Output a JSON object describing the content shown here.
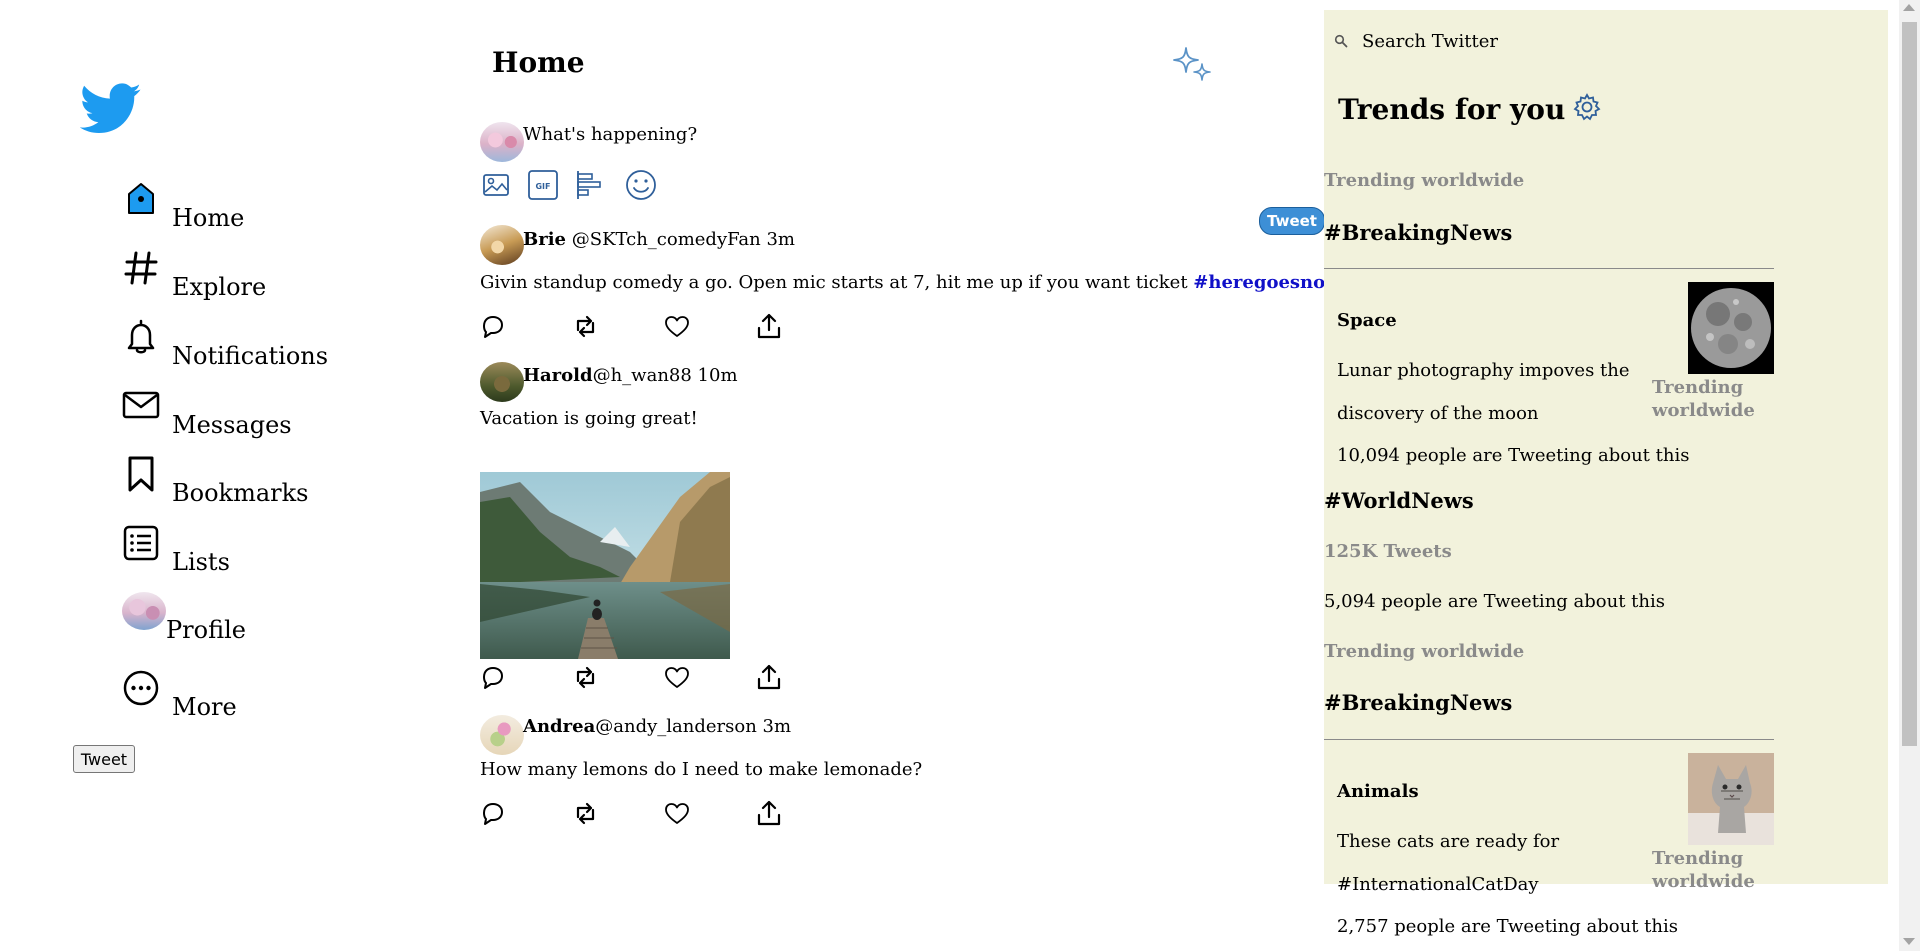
{
  "colors": {
    "brand": "#1d9bf0",
    "panel_bg": "#f2f2dc",
    "hashtag": "#1010c8",
    "muted": "#8a8a8a",
    "tweet_pill": "#3d8fd6"
  },
  "logo": {
    "icon": "twitter-bird-icon"
  },
  "nav": {
    "home": "Home",
    "explore": "Explore",
    "notifications": "Notifications",
    "messages": "Messages",
    "bookmarks": "Bookmarks",
    "lists": "Lists",
    "profile": "Profile",
    "more": "More",
    "tweet_button": "Tweet"
  },
  "feed": {
    "title": "Home",
    "composer_placeholder": "What's happening?",
    "composer_icons": [
      "image-icon",
      "gif-icon",
      "poll-icon",
      "emoji-icon"
    ]
  },
  "tweets": [
    {
      "name": "Brie",
      "meta": "@SKTch_comedyFan 3m",
      "text": "Givin standup comedy a go. Open mic starts at 7, hit me up if you want ticket ",
      "hashtag": "#heregoesnothing"
    },
    {
      "name": "Harold",
      "meta": "@h_wan88 10m",
      "text": "Vacation is going great!"
    },
    {
      "name": "Andrea",
      "meta": "@andy_landerson 3m",
      "text": "How many lemons do I need to make lemonade?"
    }
  ],
  "floating_tweet": "Tweet",
  "sidebar": {
    "search_placeholder": "Search Twitter",
    "trends_title": "Trends for you",
    "block1": {
      "label": "Trending worldwide",
      "hashtag": "#BreakingNews"
    },
    "card1": {
      "topic": "Space",
      "description": "Lunar photography impoves the discovery of the moon",
      "count": "10,094 people are Tweeting about this",
      "side_label": "Trending worldwide"
    },
    "block2": {
      "hashtag": "#WorldNews",
      "tweets": "125K Tweets",
      "count": "5,094 people are Tweeting about this"
    },
    "block3": {
      "label": "Trending worldwide",
      "hashtag": "#BreakingNews"
    },
    "card2": {
      "topic": "Animals",
      "description": "These cats are ready for #InternationalCatDay",
      "count": "2,757 people are Tweeting about this",
      "side_label": "Trending worldwide"
    }
  }
}
